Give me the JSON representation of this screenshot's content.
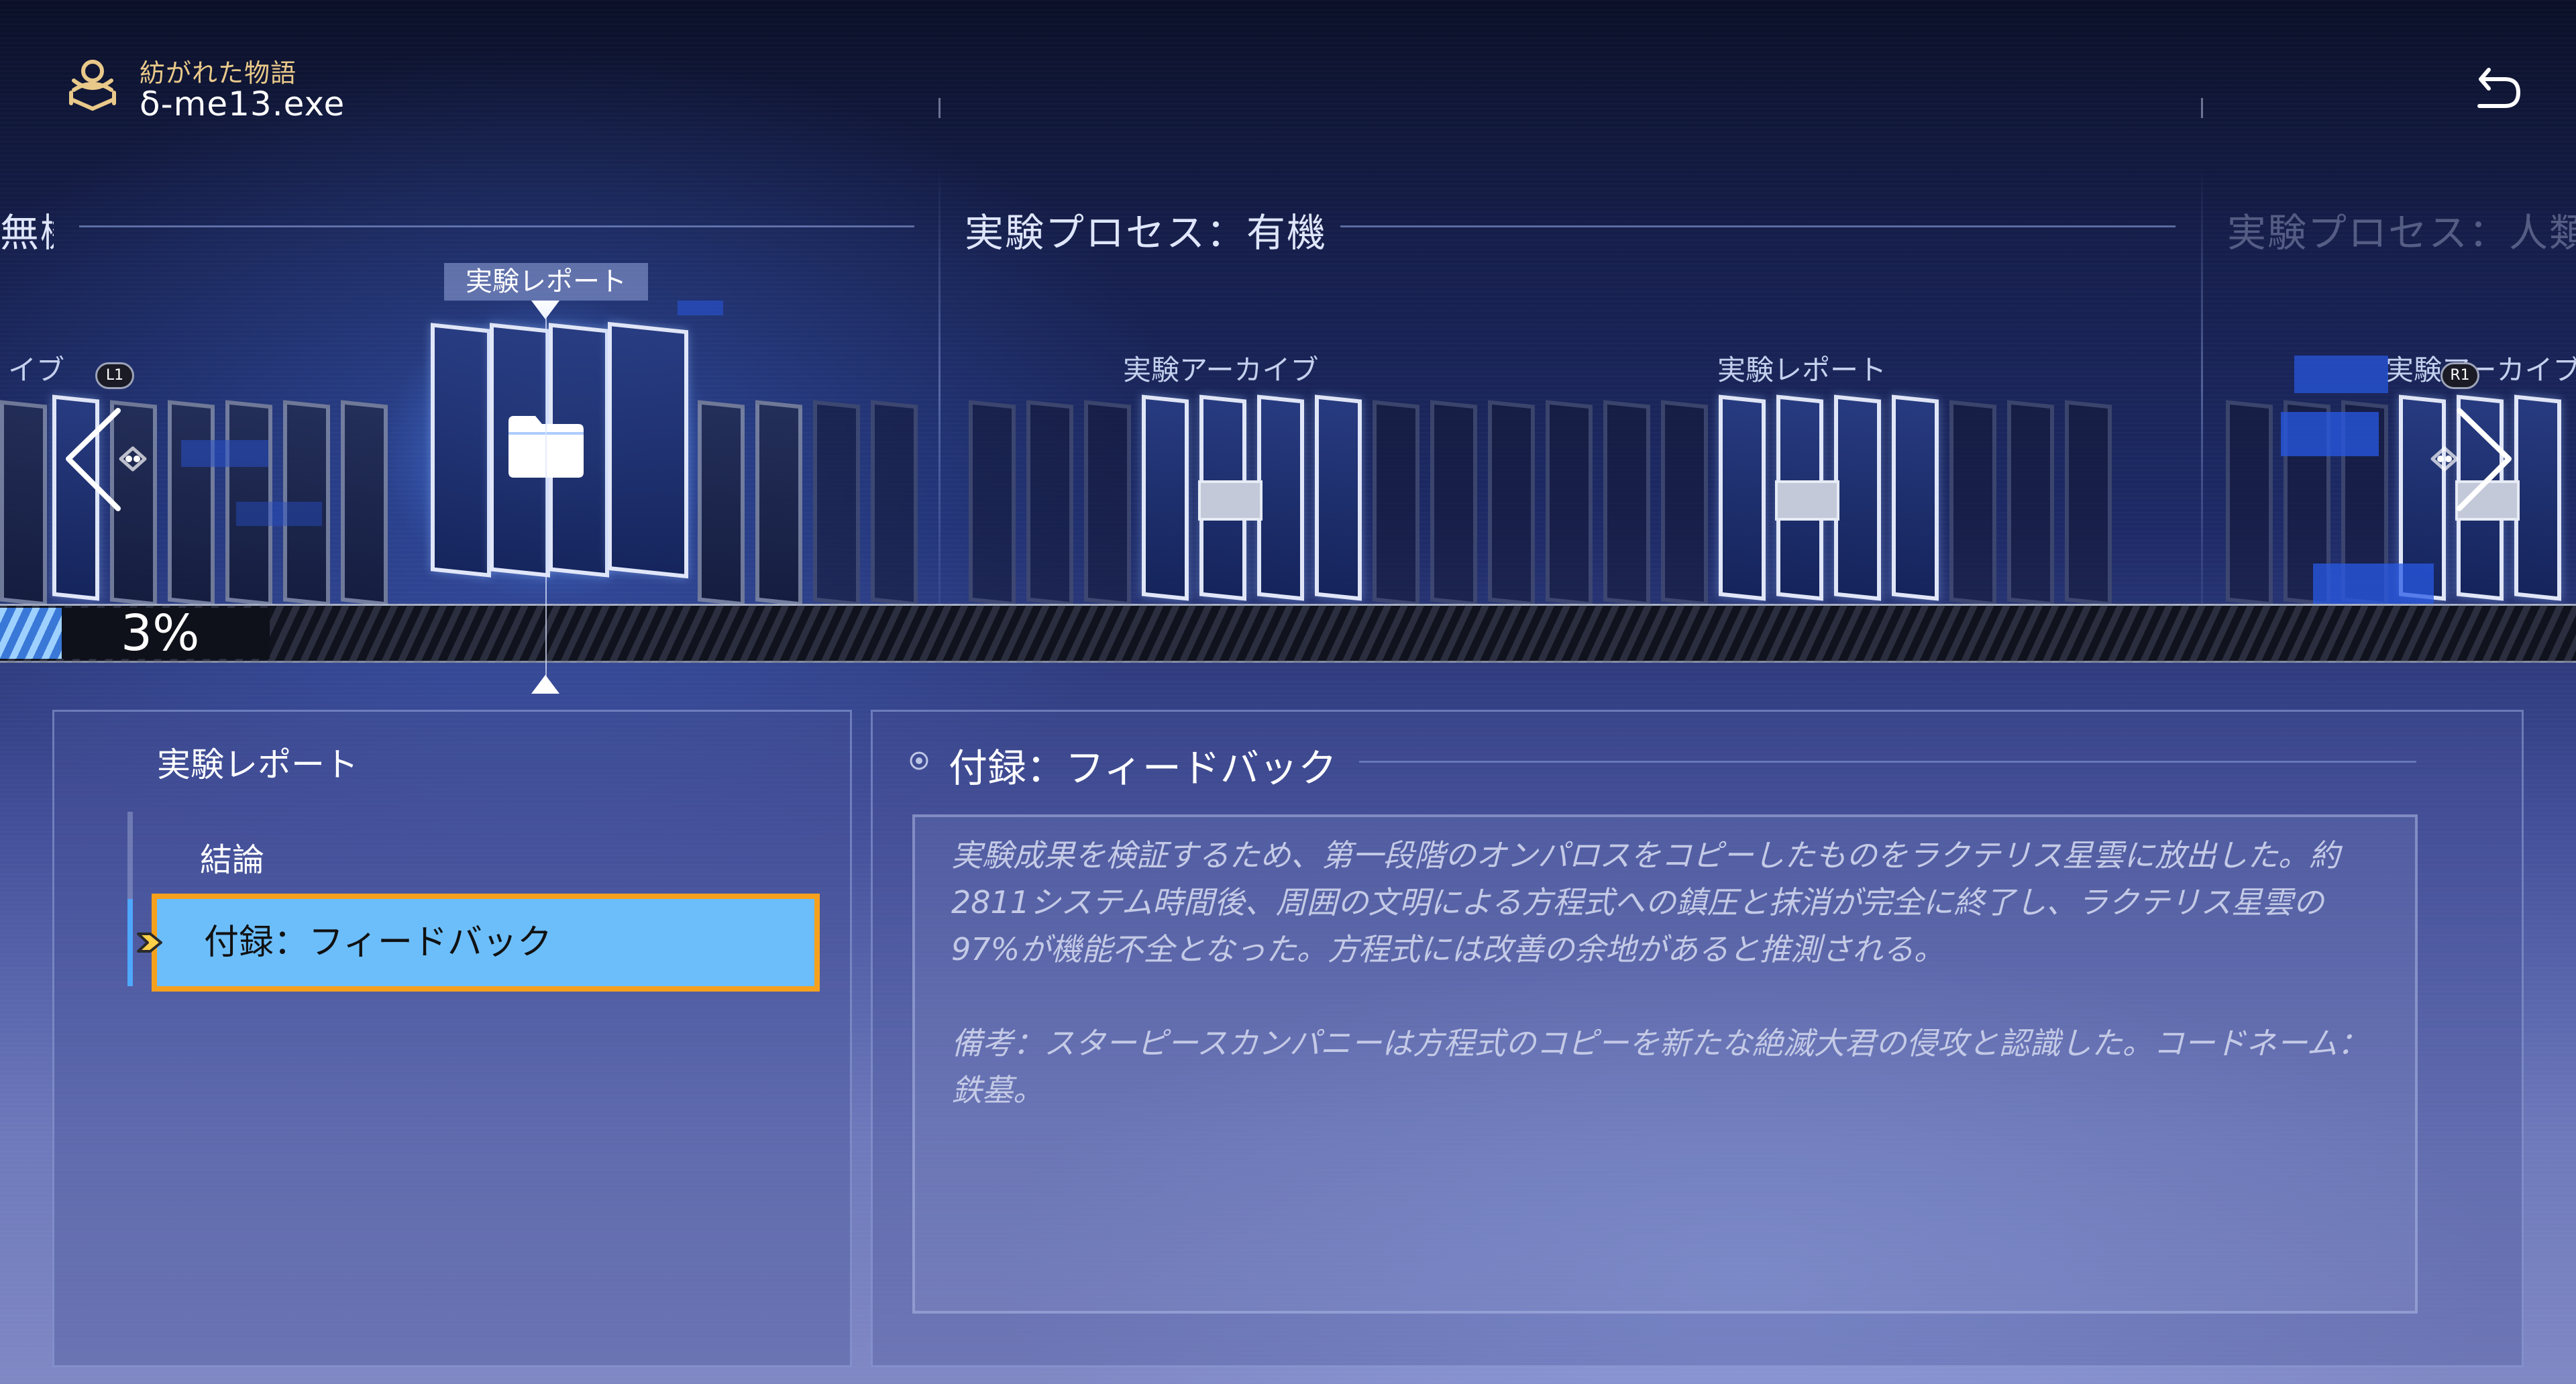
{
  "header": {
    "book_title": "紡がれた物語",
    "file_name": "δ-me13.exe"
  },
  "timeline": {
    "sections": [
      {
        "title": "無機"
      },
      {
        "title": "実験プロセス：有機"
      },
      {
        "title": "実験プロセス：人類"
      }
    ],
    "node_labels": {
      "left_partial": "イブ",
      "selected": "実験レポート",
      "organic_archive": "実験アーカイブ",
      "organic_report": "実験レポート",
      "human_archive": "実験アーカイブ"
    },
    "badges": {
      "left": "L1",
      "right": "R1"
    },
    "progress_text": "3%",
    "progress_value": 3
  },
  "list_panel": {
    "heading": "実験レポート",
    "items": [
      {
        "label": "結論"
      },
      {
        "label": "付録：フィードバック"
      }
    ]
  },
  "detail_panel": {
    "title": "付録：フィードバック",
    "paragraph1": "実験成果を検証するため、第一段階のオンパロスをコピーしたものをラクテリス星雲に放出した。約2811システム時間後、周囲の文明による方程式への鎮圧と抹消が完全に終了し、ラクテリス星雲の97%が機能不全となった。方程式には改善の余地があると推測される。",
    "paragraph2": "備考：スターピースカンパニーは方程式のコピーを新たな絶滅大君の侵攻と認識した。コードネーム：鉄墓。"
  },
  "colors": {
    "accent_gold": "#e9c98a",
    "selection_fill": "#6cbefb",
    "selection_border": "#f6a11d",
    "progress_fill": "#4ea8ff"
  },
  "icons": [
    "book-knot-icon",
    "back-arrow-icon",
    "folder-icon",
    "chevron-left-icon",
    "chevron-right-icon",
    "pointer-arrow-icon",
    "bullet-circle-icon",
    "triangle-marker-icon"
  ]
}
